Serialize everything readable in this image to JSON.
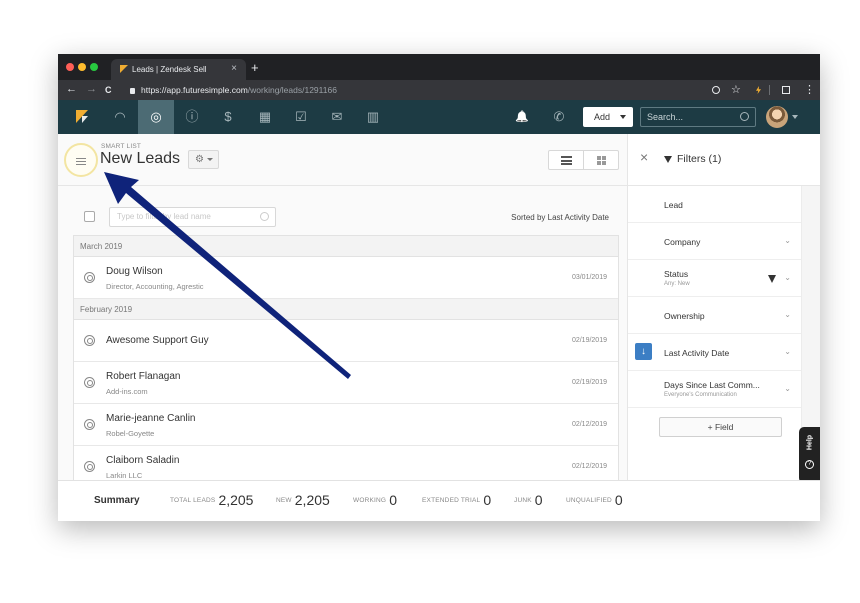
{
  "browser": {
    "tab_title": "Leads | Zendesk Sell",
    "tab_close": "×",
    "new_tab": "+",
    "back": "←",
    "forward": "→",
    "reload": "C",
    "url_host": "https://app.futuresimple.com",
    "url_path": "/working/leads/1291166",
    "zoom_icon": "zoom-icon",
    "star": "☆",
    "menu": "⋮"
  },
  "topnav": {
    "items": [
      {
        "name": "dashboard",
        "glyph": "◠"
      },
      {
        "name": "leads",
        "glyph": "◎"
      },
      {
        "name": "contacts",
        "glyph": "ⓘ"
      },
      {
        "name": "deals",
        "glyph": "$"
      },
      {
        "name": "calendar",
        "glyph": "▦"
      },
      {
        "name": "tasks",
        "glyph": "☑"
      },
      {
        "name": "communication",
        "glyph": "✉"
      },
      {
        "name": "reports",
        "glyph": "▥"
      }
    ],
    "bell": "🔔",
    "phone": "✆",
    "add_label": "Add",
    "search_placeholder": "Search..."
  },
  "header": {
    "smart_list_label": "SMART LIST",
    "title": "New Leads",
    "gear": "⚙"
  },
  "toolbar": {
    "filter_placeholder": "Type to filter by lead name",
    "sorted_label": "Sorted by Last Activity Date"
  },
  "groups": [
    {
      "label": "March 2019",
      "rows": [
        {
          "name": "Doug Wilson",
          "sub": "Director, Accounting, Agrestic",
          "date": "03/01/2019"
        }
      ]
    },
    {
      "label": "February 2019",
      "rows": [
        {
          "name": "Awesome Support Guy",
          "sub": "",
          "date": "02/19/2019"
        },
        {
          "name": "Robert Flanagan",
          "sub": "Add-ins.com",
          "date": "02/19/2019"
        },
        {
          "name": "Marie-jeanne Canlin",
          "sub": "Robel-Goyette",
          "date": "02/12/2019"
        },
        {
          "name": "Claiborn Saladin",
          "sub": "Larkin LLC",
          "date": "02/12/2019"
        }
      ]
    }
  ],
  "filters": {
    "close": "×",
    "title": "Filters (1)",
    "items": [
      {
        "label": "Lead",
        "sub": ""
      },
      {
        "label": "Company",
        "sub": ""
      },
      {
        "label": "Status",
        "sub": "Any: New"
      },
      {
        "label": "Ownership",
        "sub": ""
      },
      {
        "label": "Last Activity Date",
        "sub": ""
      },
      {
        "label": "Days Since Last Comm...",
        "sub": "Everyone's Communication"
      }
    ],
    "sort_arrow": "↓",
    "chevron": "⌄",
    "add_field": "+ Field"
  },
  "help": {
    "label": "Help",
    "icon": "?"
  },
  "summary": {
    "title": "Summary",
    "stats": [
      {
        "label": "TOTAL LEADS",
        "value": "2,205"
      },
      {
        "label": "NEW",
        "value": "2,205"
      },
      {
        "label": "WORKING",
        "value": "0"
      },
      {
        "label": "EXTENDED TRIAL",
        "value": "0"
      },
      {
        "label": "JUNK",
        "value": "0"
      },
      {
        "label": "UNQUALIFIED",
        "value": "0"
      }
    ]
  },
  "colors": {
    "app_nav": "#1d3b44",
    "nav_active": "#4c6b74",
    "accent_blue": "#3c7ec4",
    "logo_orange": "#f0ad32",
    "arrow": "#0f237a",
    "highlight_ring": "#f3e5a2"
  }
}
